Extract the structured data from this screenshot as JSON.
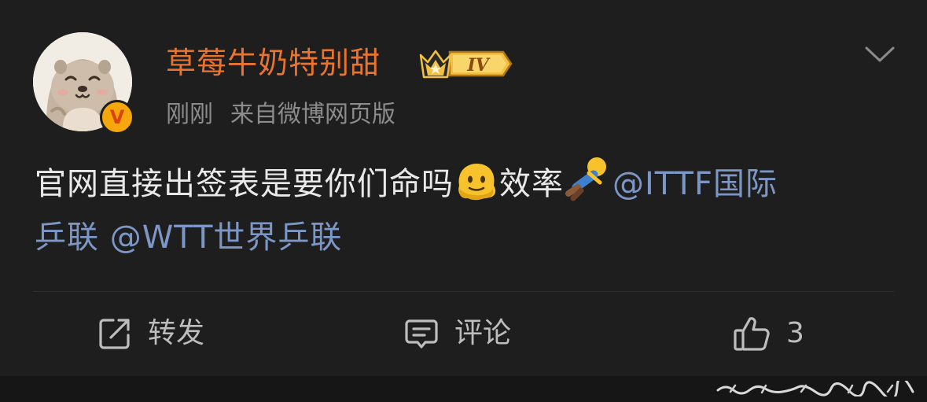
{
  "post": {
    "author": "草莓牛奶特别甜",
    "level_badge": "IV",
    "time": "刚刚",
    "source": "来自微博网页版",
    "content": {
      "text1": "官网直接出签表是要你们命吗",
      "emoji1": "melting-face-emoji",
      "text2": "效率",
      "emoji2": "runaway-emoji",
      "mention1_line1": "@ITTF国际",
      "mention1_line2": "乒联",
      "mention2": "@WTT世界乒联"
    }
  },
  "actions": {
    "repost_label": "转发",
    "comment_label": "评论",
    "like_count": "3"
  },
  "colors": {
    "background": "#1e1e1e",
    "username": "#e8742f",
    "mention": "#7c97c6",
    "meta": "#8c8c8c",
    "verified": "#f5a70c"
  }
}
